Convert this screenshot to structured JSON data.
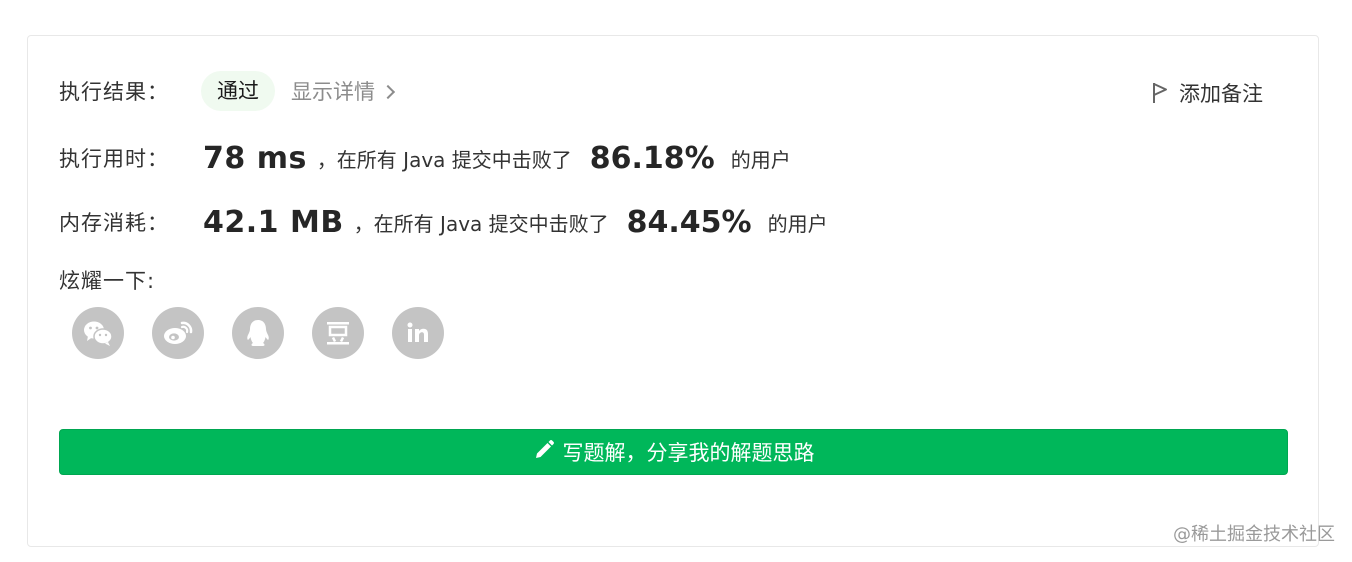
{
  "result": {
    "label": "执行结果：",
    "status": "通过",
    "detail_link": "显示详情"
  },
  "add_note": {
    "label": "添加备注",
    "icon": "flag-icon"
  },
  "time": {
    "label": "执行用时：",
    "value": "78 ms",
    "mid_text": "，在所有 Java 提交中击败了",
    "percent": "86.18%",
    "suffix": "的用户"
  },
  "memory": {
    "label": "内存消耗：",
    "value": "42.1 MB",
    "mid_text": "，在所有 Java 提交中击败了",
    "percent": "84.45%",
    "suffix": "的用户"
  },
  "share": {
    "label": "炫耀一下:",
    "icons": [
      "wechat-icon",
      "weibo-icon",
      "qq-icon",
      "douban-icon",
      "linkedin-icon"
    ]
  },
  "write_button": {
    "label": "写题解，分享我的解题思路",
    "icon": "pencil-icon"
  },
  "watermark": "@稀土掘金技术社区",
  "colors": {
    "accent_green": "#00b75a",
    "badge_bg": "#f0faf0",
    "icon_gray": "#c4c4c4"
  }
}
